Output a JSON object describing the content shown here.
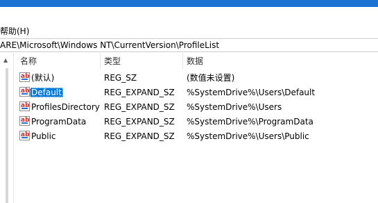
{
  "menu": {
    "help_label": "帮助(H)"
  },
  "address": {
    "path": "ARE\\Microsoft\\Windows NT\\CurrentVersion\\ProfileList"
  },
  "columns": {
    "name": "名称",
    "type": "类型",
    "data": "数据"
  },
  "icon_label": "ab",
  "rows": [
    {
      "name": "(默认)",
      "type": "REG_SZ",
      "data": "(数值未设置)"
    },
    {
      "name": "Default",
      "type": "REG_EXPAND_SZ",
      "data": "%SystemDrive%\\Users\\Default",
      "selected": true
    },
    {
      "name": "ProfilesDirectory",
      "type": "REG_EXPAND_SZ",
      "data": "%SystemDrive%\\Users"
    },
    {
      "name": "ProgramData",
      "type": "REG_EXPAND_SZ",
      "data": "%SystemDrive%\\ProgramData"
    },
    {
      "name": "Public",
      "type": "REG_EXPAND_SZ",
      "data": "%SystemDrive%\\Users\\Public"
    }
  ],
  "colors": {
    "accent": "#1b74d2",
    "selection": "#0078d7",
    "icon_text": "#c62828",
    "icon_underline": "#2a6fd6"
  }
}
